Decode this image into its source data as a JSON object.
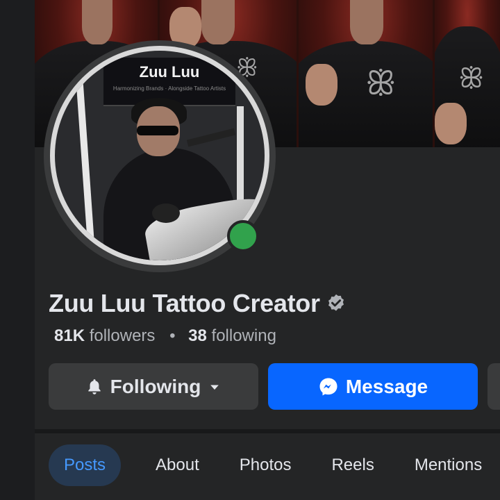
{
  "profile": {
    "name": "Zuu Luu Tattoo Creator",
    "verified": true,
    "online": true,
    "avatar_sign_title": "Zuu Luu",
    "avatar_sign_subtitle": "Harmonizing Brands · Alongside Tattoo Artists"
  },
  "stats": {
    "followers_count": "81K",
    "followers_label": "followers",
    "separator": "•",
    "following_count": "38",
    "following_label": "following"
  },
  "actions": {
    "following_label": "Following",
    "message_label": "Message"
  },
  "tabs": [
    {
      "label": "Posts",
      "active": true
    },
    {
      "label": "About",
      "active": false
    },
    {
      "label": "Photos",
      "active": false
    },
    {
      "label": "Reels",
      "active": false
    },
    {
      "label": "Mentions",
      "active": false
    }
  ],
  "colors": {
    "background": "#242526",
    "primary_button": "#0866ff",
    "secondary_button": "#3a3b3c",
    "active_tab_bg": "#263951",
    "active_tab_text": "#4599ff",
    "online": "#31a24c"
  },
  "icons": {
    "verified": "verified-badge-icon",
    "following": "bell-icon",
    "dropdown": "caret-down-icon",
    "message": "messenger-icon"
  }
}
